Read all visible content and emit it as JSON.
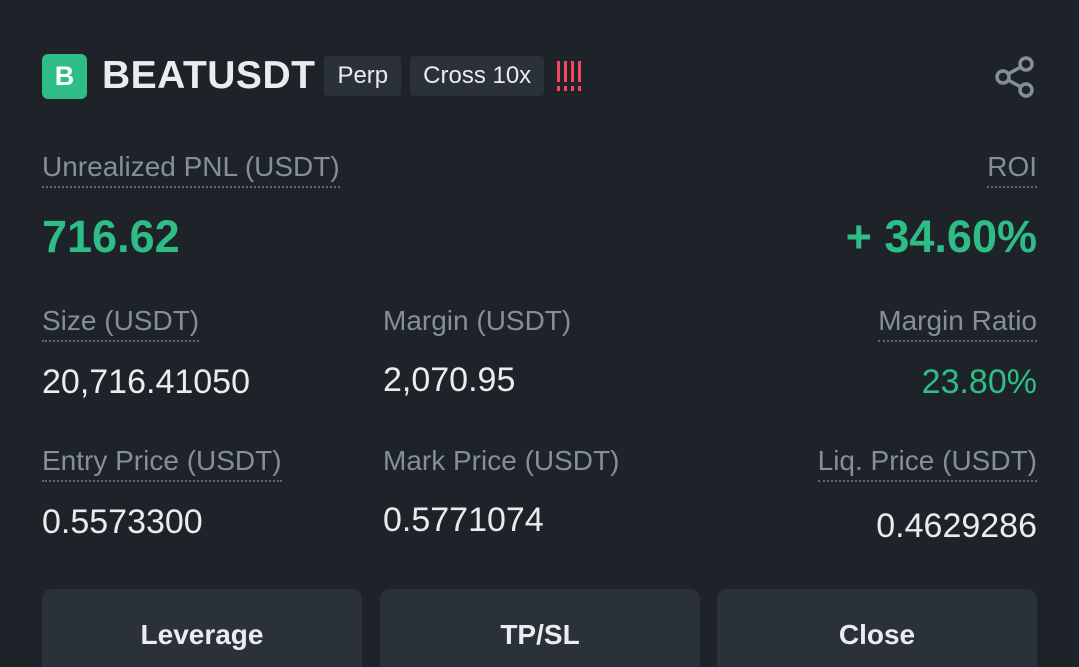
{
  "position": {
    "coin_letter": "B",
    "symbol": "BEATUSDT",
    "contract_type": "Perp",
    "margin_mode": "Cross 10x",
    "share_icon": "share-icon",
    "warning_icon": "risk-bars-icon"
  },
  "pnl": {
    "label": "Unrealized PNL (USDT)",
    "value": "716.62"
  },
  "roi": {
    "label": "ROI",
    "value": "+ 34.60%"
  },
  "size": {
    "label": "Size (USDT)",
    "value": "20,716.41050"
  },
  "margin": {
    "label": "Margin (USDT)",
    "value": "2,070.95"
  },
  "margin_ratio": {
    "label": "Margin Ratio",
    "value": "23.80%"
  },
  "entry_price": {
    "label": "Entry Price (USDT)",
    "value": "0.5573300"
  },
  "mark_price": {
    "label": "Mark Price (USDT)",
    "value": "0.5771074"
  },
  "liq_price": {
    "label": "Liq. Price (USDT)",
    "value": "0.4629286"
  },
  "actions": {
    "leverage": "Leverage",
    "tpsl": "TP/SL",
    "close": "Close"
  },
  "colors": {
    "background": "#1e2329",
    "profit_green": "#2ebd85",
    "warning_red": "#f6465d",
    "button_bg": "#2b3139"
  }
}
